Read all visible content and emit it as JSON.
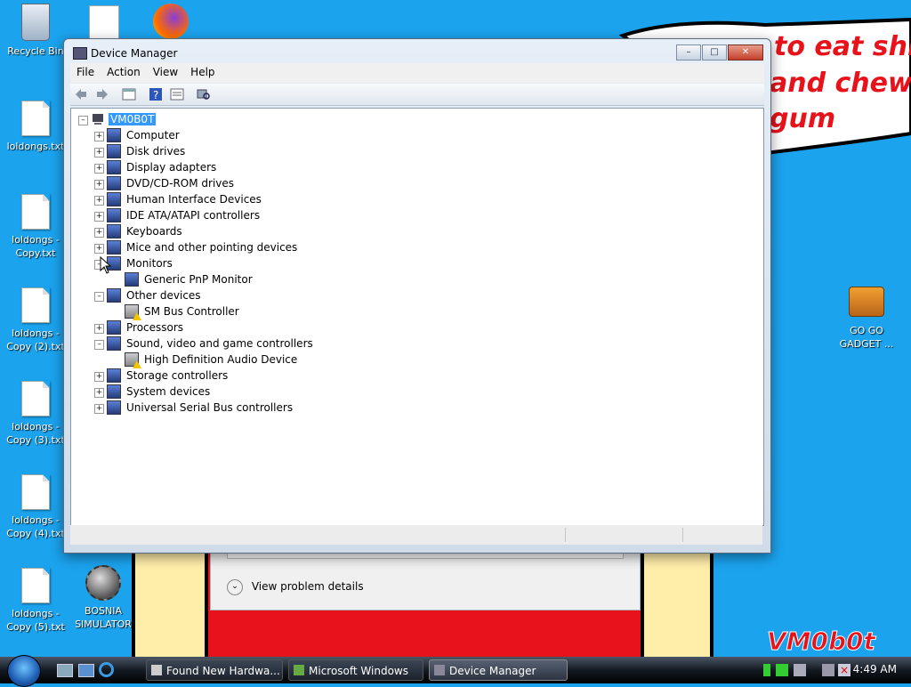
{
  "desktop": {
    "wallpaper_text": [
      "to eat shit",
      "and chew",
      "gum"
    ],
    "signature": "VM0b0t",
    "icons": [
      {
        "label": "Recycle Bin"
      },
      {
        "label": "loldongs.txt"
      },
      {
        "label": "loldongs - Copy.txt"
      },
      {
        "label": "loldongs - Copy (2).txt"
      },
      {
        "label": "loldongs - Copy (3).txt"
      },
      {
        "label": "loldongs - Copy (4).txt"
      },
      {
        "label": "loldongs - Copy (5).txt"
      },
      {
        "label": "BOSNIA SIMULATOR"
      },
      {
        "label": "GO GO GADGET ..."
      }
    ]
  },
  "window": {
    "title": "Device Manager",
    "menu": [
      "File",
      "Action",
      "View",
      "Help"
    ],
    "tree": {
      "root": "VM0B0T",
      "items": [
        {
          "label": "Computer",
          "exp": "+"
        },
        {
          "label": "Disk drives",
          "exp": "+"
        },
        {
          "label": "Display adapters",
          "exp": "+"
        },
        {
          "label": "DVD/CD-ROM drives",
          "exp": "+"
        },
        {
          "label": "Human Interface Devices",
          "exp": "+"
        },
        {
          "label": "IDE ATA/ATAPI controllers",
          "exp": "+"
        },
        {
          "label": "Keyboards",
          "exp": "+"
        },
        {
          "label": "Mice and other pointing devices",
          "exp": "+"
        },
        {
          "label": "Monitors",
          "exp": "-"
        },
        {
          "label": "Generic PnP Monitor",
          "child": true
        },
        {
          "label": "Other devices",
          "exp": "-"
        },
        {
          "label": "SM Bus Controller",
          "child": true,
          "warn": true
        },
        {
          "label": "Processors",
          "exp": "+"
        },
        {
          "label": "Sound, video and game controllers",
          "exp": "-"
        },
        {
          "label": "High Definition Audio Device",
          "child": true,
          "warn": true
        },
        {
          "label": "Storage controllers",
          "exp": "+"
        },
        {
          "label": "System devices",
          "exp": "+"
        },
        {
          "label": "Universal Serial Bus controllers",
          "exp": "+"
        }
      ]
    }
  },
  "background_dialog": {
    "details_label": "View problem details"
  },
  "taskbar": {
    "tasks": [
      "Found New Hardwa...",
      "Microsoft Windows",
      "Device Manager"
    ],
    "clock": "4:49 AM"
  }
}
